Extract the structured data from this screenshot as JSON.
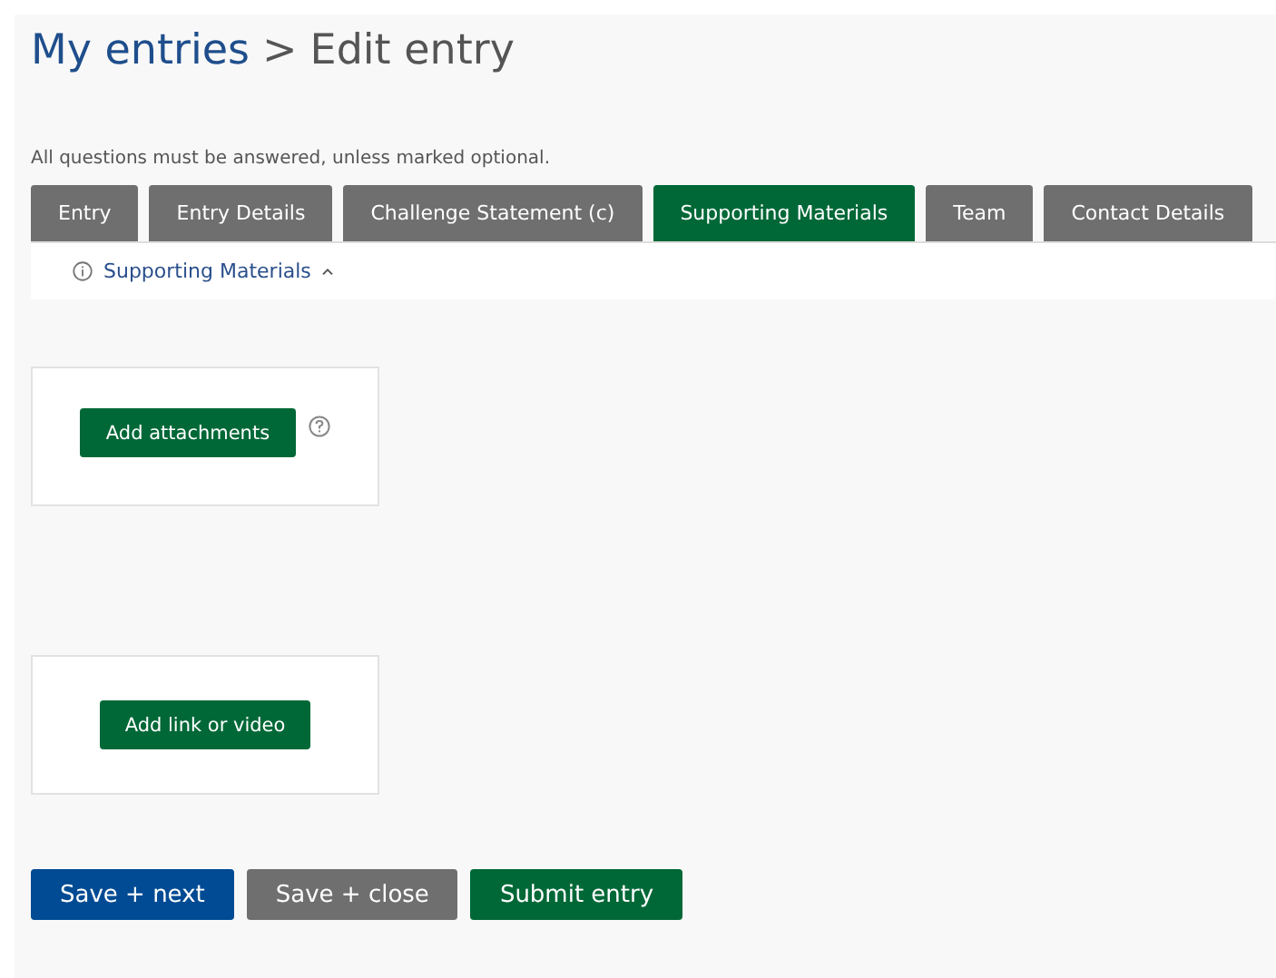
{
  "breadcrumb": {
    "link": "My entries",
    "separator": ">",
    "current": "Edit entry"
  },
  "note": "All questions must be answered, unless marked optional.",
  "tabs": [
    {
      "label": "Entry",
      "selected": false
    },
    {
      "label": "Entry Details",
      "selected": false
    },
    {
      "label": "Challenge Statement (c)",
      "selected": false
    },
    {
      "label": "Supporting Materials",
      "selected": true
    },
    {
      "label": "Team",
      "selected": false
    },
    {
      "label": "Contact Details",
      "selected": false
    }
  ],
  "section": {
    "title": "Supporting Materials",
    "expanded": true
  },
  "cards": [
    {
      "button": "Add attachments",
      "help": true
    },
    {
      "button": "Add link or video",
      "help": false
    }
  ],
  "actions": [
    {
      "label": "Save + next",
      "kind": "primary"
    },
    {
      "label": "Save + close",
      "kind": "secondary"
    },
    {
      "label": "Submit entry",
      "kind": "success"
    }
  ]
}
